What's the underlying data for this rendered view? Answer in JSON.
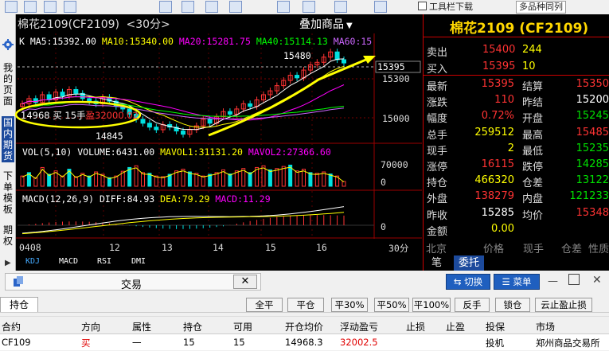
{
  "topbar": {
    "toolbar_label": "工具栏下载",
    "time_label": "多品种同列"
  },
  "sidebar": {
    "items": [
      "我的页面",
      "国内期货",
      "下单模板",
      "期权"
    ]
  },
  "chart": {
    "title_name": "棉花2109",
    "title_code": "(CF2109)",
    "period": "<30分>",
    "overlay_label": "叠加商品",
    "ma_k": "K",
    "ma5": "MA5:15392.00",
    "ma10": "MA10:15340.00",
    "ma20": "MA20:15281.75",
    "ma40": "MA40:15114.13",
    "ma60": "MA60:15",
    "vol_label": "VOL(5,10)",
    "volume": "VOLUME:6431.00",
    "mavol1": "MAVOL1:31131.20",
    "mavol2": "MAVOL2:27366.60",
    "macd_label": "MACD(12,26,9)",
    "diff": "DIFF:84.93",
    "dea": "DEA:79.29",
    "macd": "MACD:11.29",
    "high_mark": "15480",
    "low_mark": "14845",
    "price_now": "15395",
    "price_ticks": [
      "15300",
      "15000"
    ],
    "vol_ticks": [
      "70000",
      "0"
    ],
    "macd_ticks": [
      "0"
    ],
    "x_ticks": [
      "0408",
      "12",
      "13",
      "14",
      "15",
      "16",
      "30分"
    ],
    "position_label": {
      "price": "14968",
      "side": "买",
      "qty": "15手",
      "pnl": "盈32000.02"
    },
    "indicator_tabs": [
      "KDJ",
      "MACD",
      "RSI",
      "DMI"
    ]
  },
  "quote": {
    "title": "棉花2109 (CF2109)",
    "sell_label": "卖出",
    "sell_price": "15400",
    "sell_vol": "244",
    "buy_label": "买入",
    "buy_price": "15395",
    "buy_vol": "10",
    "rows": [
      {
        "l1": "最新",
        "v1": "15395",
        "c1": "red",
        "l2": "结算",
        "v2": "15350",
        "c2": "red"
      },
      {
        "l1": "涨跌",
        "v1": "110",
        "c1": "red",
        "l2": "昨结",
        "v2": "15200",
        "c2": "white"
      },
      {
        "l1": "幅度",
        "v1": "0.72%",
        "c1": "red",
        "l2": "开盘",
        "v2": "15245",
        "c2": "green"
      },
      {
        "l1": "总手",
        "v1": "259512",
        "c1": "yellow",
        "l2": "最高",
        "v2": "15485",
        "c2": "red"
      },
      {
        "l1": "现手",
        "v1": "2",
        "c1": "yellow",
        "l2": "最低",
        "v2": "15235",
        "c2": "green"
      },
      {
        "l1": "涨停",
        "v1": "16115",
        "c1": "red",
        "l2": "跌停",
        "v2": "14285",
        "c2": "green"
      },
      {
        "l1": "持仓",
        "v1": "466320",
        "c1": "yellow",
        "l2": "仓差",
        "v2": "13122",
        "c2": "green"
      },
      {
        "l1": "外盘",
        "v1": "138279",
        "c1": "red",
        "l2": "内盘",
        "v2": "121233",
        "c2": "green"
      },
      {
        "l1": "昨收",
        "v1": "15285",
        "c1": "white",
        "l2": "均价",
        "v2": "15348",
        "c2": "red"
      },
      {
        "l1": "金额",
        "v1": "0.00",
        "c1": "yellow",
        "l2": "",
        "v2": "",
        "c2": "white"
      }
    ],
    "footer": [
      "北京",
      "价格",
      "现手",
      "仓差",
      "性质"
    ],
    "tabs": [
      "笔",
      "委托"
    ]
  },
  "trade": {
    "title": "交易",
    "switch_label": "切换",
    "menu_label": "菜单",
    "tab_position": "持仓",
    "buttons": [
      "全平",
      "平仓",
      "平30%",
      "平50%",
      "平100%",
      "反手",
      "锁仓",
      "云止盈止损"
    ],
    "columns": [
      "合约",
      "方向",
      "属性",
      "持仓",
      "可用",
      "开仓均价",
      "浮动盈亏",
      "止损",
      "止盈",
      "投保",
      "市场"
    ],
    "row": [
      "CF109",
      "买",
      "一",
      "15",
      "15",
      "14968.3",
      "32002.5",
      "",
      "",
      "投机",
      "郑州商品交易所"
    ]
  },
  "colors": {
    "bull": "#ff3333",
    "bear": "#00e0e0",
    "accent": "#1f5fbf",
    "ma5": "#ffffff",
    "ma10": "#ffff00",
    "ma20": "#ff00ff",
    "ma40": "#00ff00",
    "ma60": "#cc66ff"
  }
}
